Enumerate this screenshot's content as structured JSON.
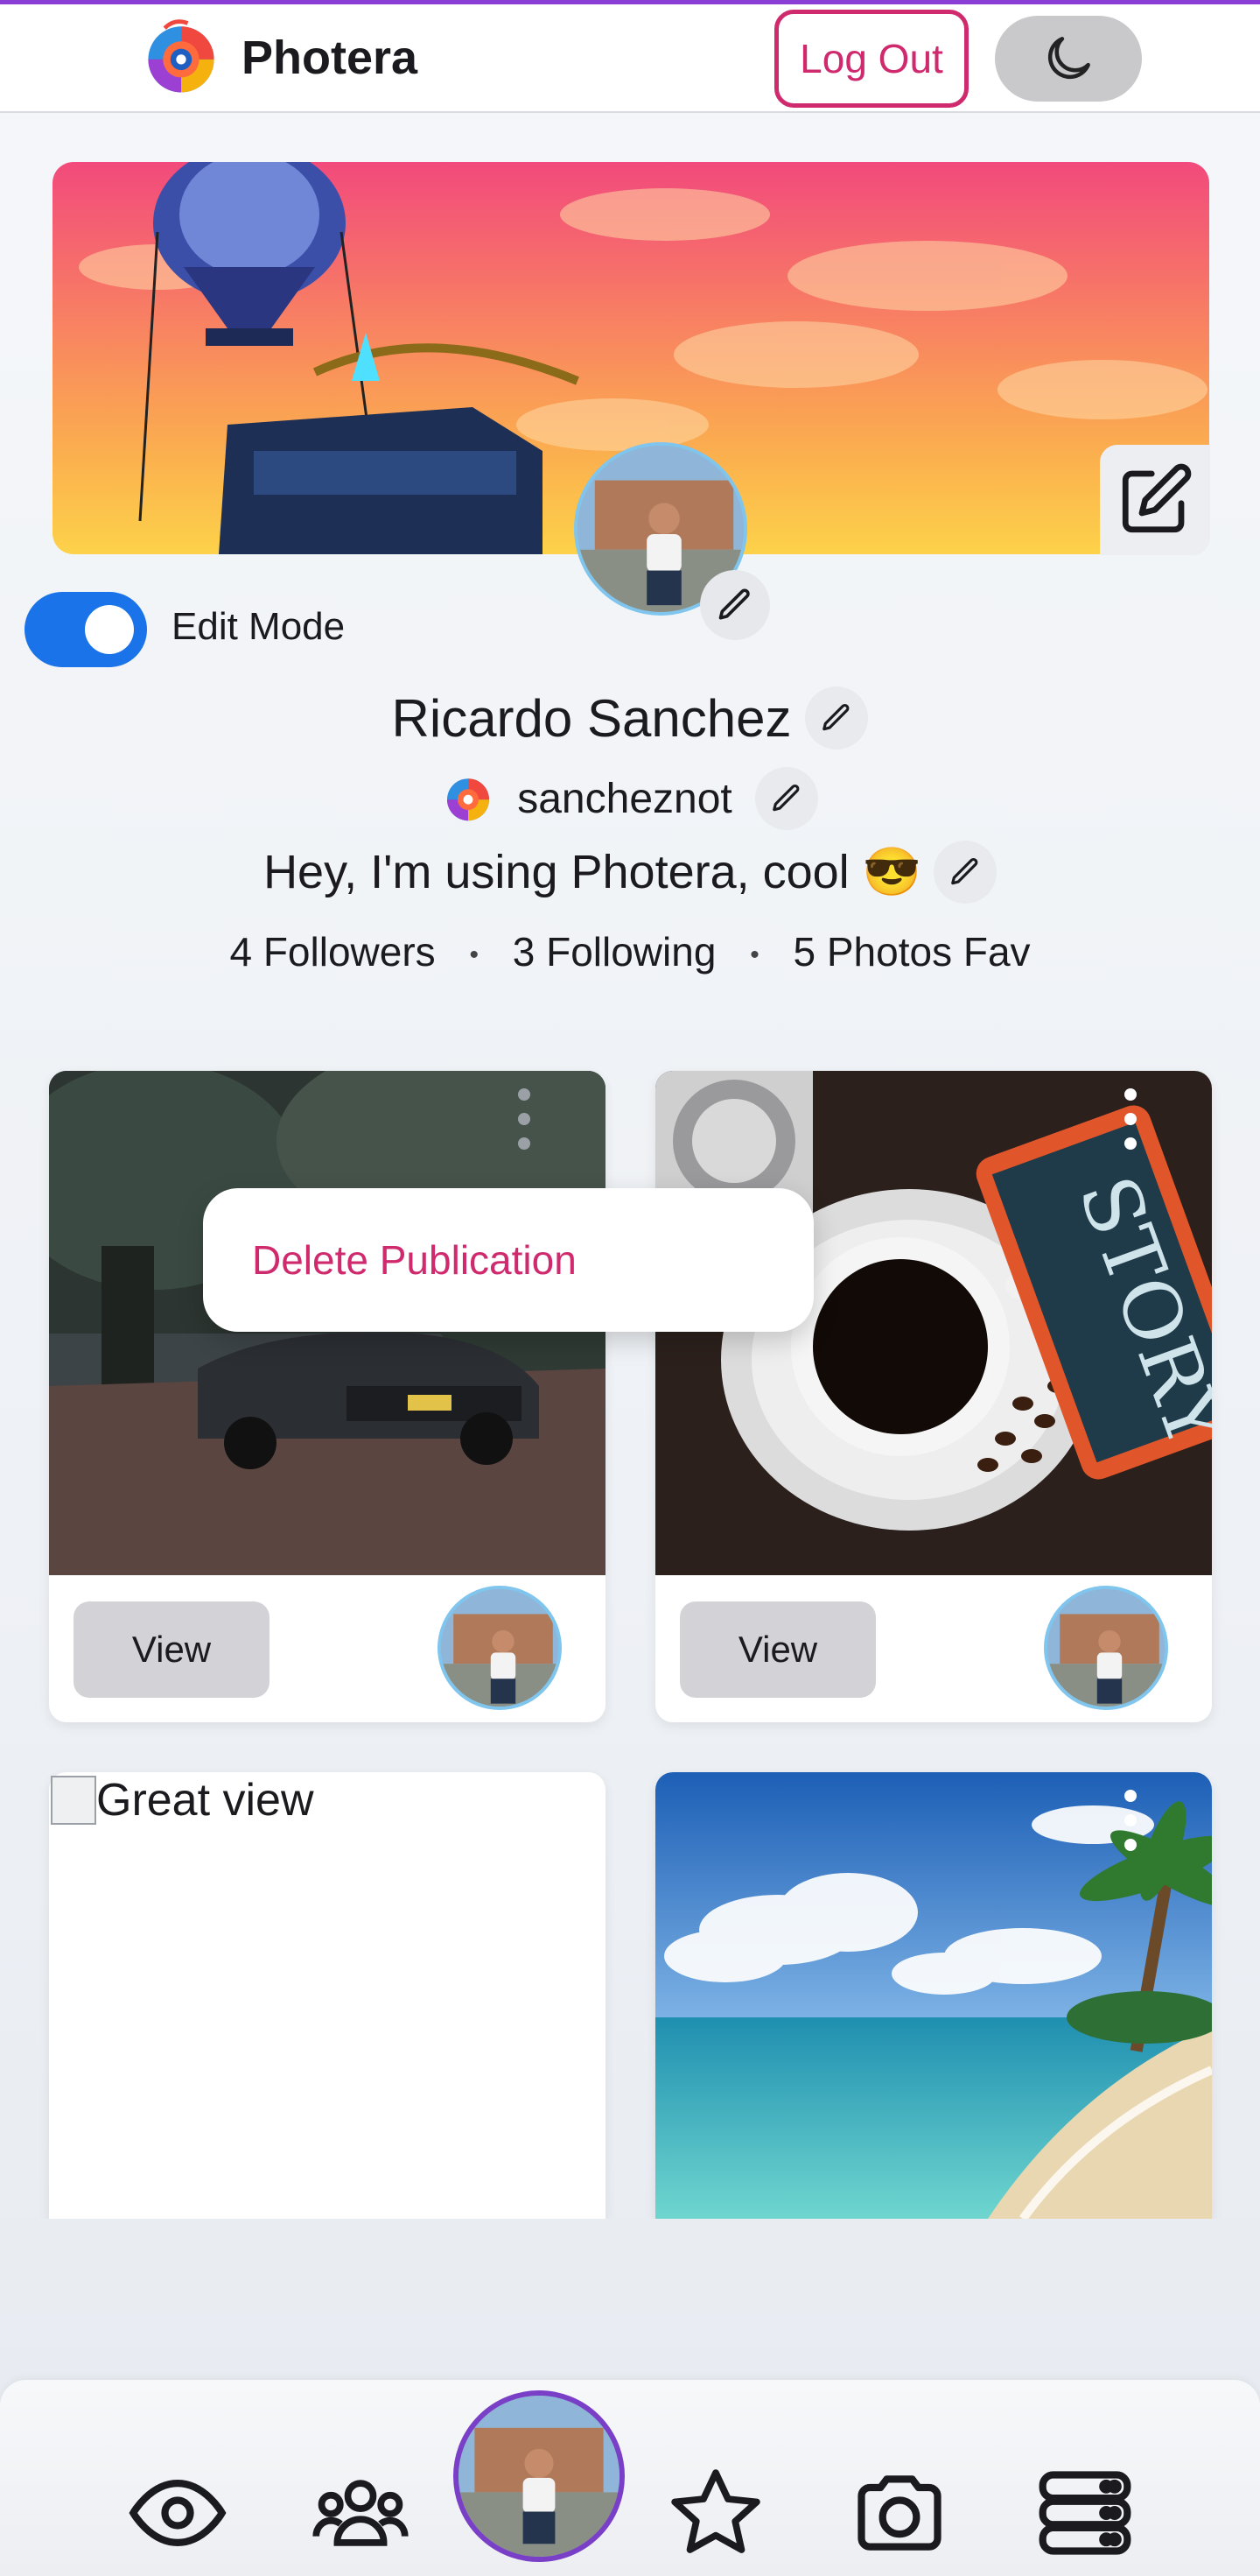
{
  "app": {
    "name": "Photera"
  },
  "header": {
    "logout_label": "Log Out",
    "theme_icon": "moon-icon"
  },
  "profile": {
    "edit_mode_label": "Edit Mode",
    "edit_mode_on": true,
    "full_name": "Ricardo Sanchez",
    "username": "sancheznot",
    "bio": "Hey, I'm using Photera, cool 😎",
    "stats": {
      "followers": "4 Followers",
      "following": "3 Following",
      "favs": "5 Photos Fav"
    }
  },
  "context_menu": {
    "delete_label": "Delete Publication"
  },
  "posts": [
    {
      "view_label": "View",
      "subject": "car"
    },
    {
      "view_label": "View",
      "subject": "coffee"
    },
    {
      "alt_text": "Great view",
      "broken": true
    },
    {
      "subject": "beach"
    }
  ],
  "bottom_nav": {
    "items": [
      "eye-icon",
      "users-icon",
      "profile-avatar",
      "star-icon",
      "camera-icon",
      "server-icon"
    ]
  },
  "colors": {
    "accent": "#cf2a6d",
    "toggle": "#1a73e8",
    "nav_ring": "#7a3fc7"
  }
}
